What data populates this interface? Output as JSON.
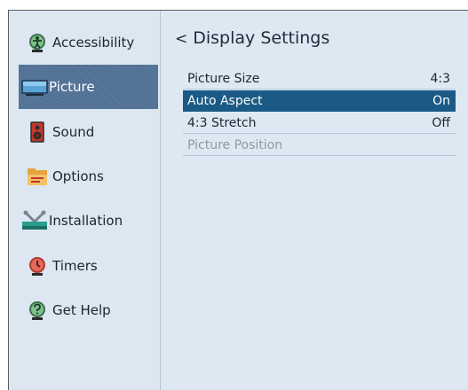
{
  "sidebar": {
    "items": [
      {
        "label": "Accessibility",
        "icon": "accessibility-icon"
      },
      {
        "label": "Picture",
        "icon": "picture-monitor-icon",
        "selected": true
      },
      {
        "label": "Sound",
        "icon": "speaker-icon"
      },
      {
        "label": "Options",
        "icon": "options-folder-icon"
      },
      {
        "label": "Installation",
        "icon": "installation-tools-icon"
      },
      {
        "label": "Timers",
        "icon": "timer-icon"
      },
      {
        "label": "Get Help",
        "icon": "help-icon"
      }
    ]
  },
  "breadcrumb": {
    "chevron": "<",
    "title": "Display Settings"
  },
  "menu": {
    "items": [
      {
        "label": "Picture Size",
        "value": "4:3"
      },
      {
        "label": "Auto Aspect",
        "value": "On",
        "selected": true
      },
      {
        "label": "4:3 Stretch",
        "value": "Off"
      },
      {
        "label": "Picture Position",
        "value": "",
        "disabled": true
      }
    ]
  },
  "colors": {
    "background": "#dde8f3",
    "selection_sidebar": "#56769a",
    "selection_menu": "#1a5a85",
    "disabled_text": "#8f9aa6"
  }
}
